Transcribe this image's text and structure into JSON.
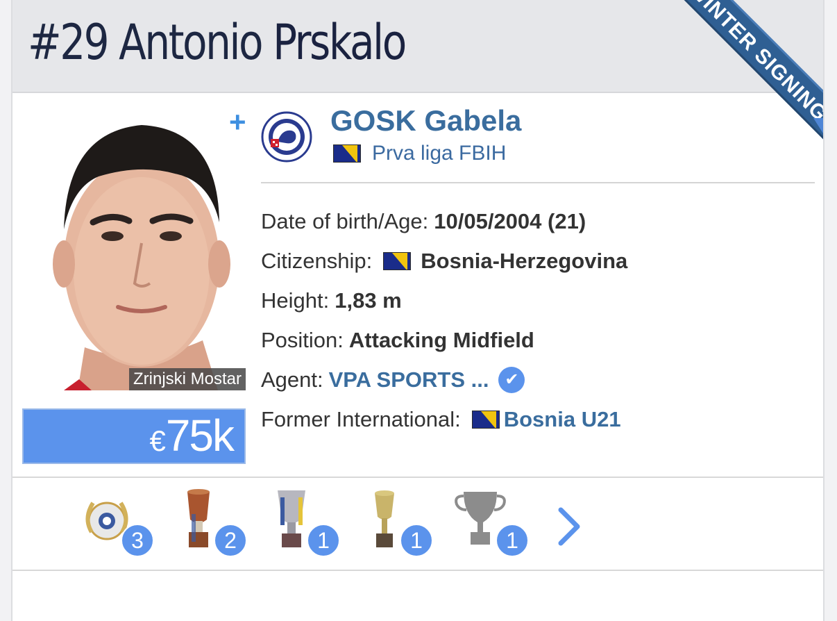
{
  "header": {
    "number": "#29",
    "first_name": "Antonio",
    "last_name": "Prskalo",
    "ribbon": "WINTER SIGNING"
  },
  "photo": {
    "caption": "Zrinjski Mostar",
    "add_symbol": "+"
  },
  "market_value": {
    "currency": "€",
    "amount": "75k"
  },
  "club": {
    "name": "GOSK Gabela",
    "league": "Prva liga FBIH"
  },
  "details": {
    "dob_label": "Date of birth/Age:",
    "dob_value": "10/05/2004 (21)",
    "citizenship_label": "Citizenship:",
    "citizenship_value": "Bosnia-Herzegovina",
    "height_label": "Height:",
    "height_value": "1,83 m",
    "position_label": "Position:",
    "position_value": "Attacking Midfield",
    "agent_label": "Agent:",
    "agent_value": "VPA SPORTS ...",
    "intl_label": "Former International:",
    "intl_value": "Bosnia U21"
  },
  "trophies": [
    {
      "icon": "laurel-wreath-icon",
      "count": "3"
    },
    {
      "icon": "cup-trophy-icon",
      "count": "2"
    },
    {
      "icon": "silver-cup-icon",
      "count": "1"
    },
    {
      "icon": "gold-cup-icon",
      "count": "1"
    },
    {
      "icon": "grey-trophy-icon",
      "count": "1"
    }
  ],
  "colors": {
    "accent": "#5b93ec",
    "link": "#3a6d9e",
    "title": "#1d2742",
    "ribbon": "#2f5f93"
  }
}
